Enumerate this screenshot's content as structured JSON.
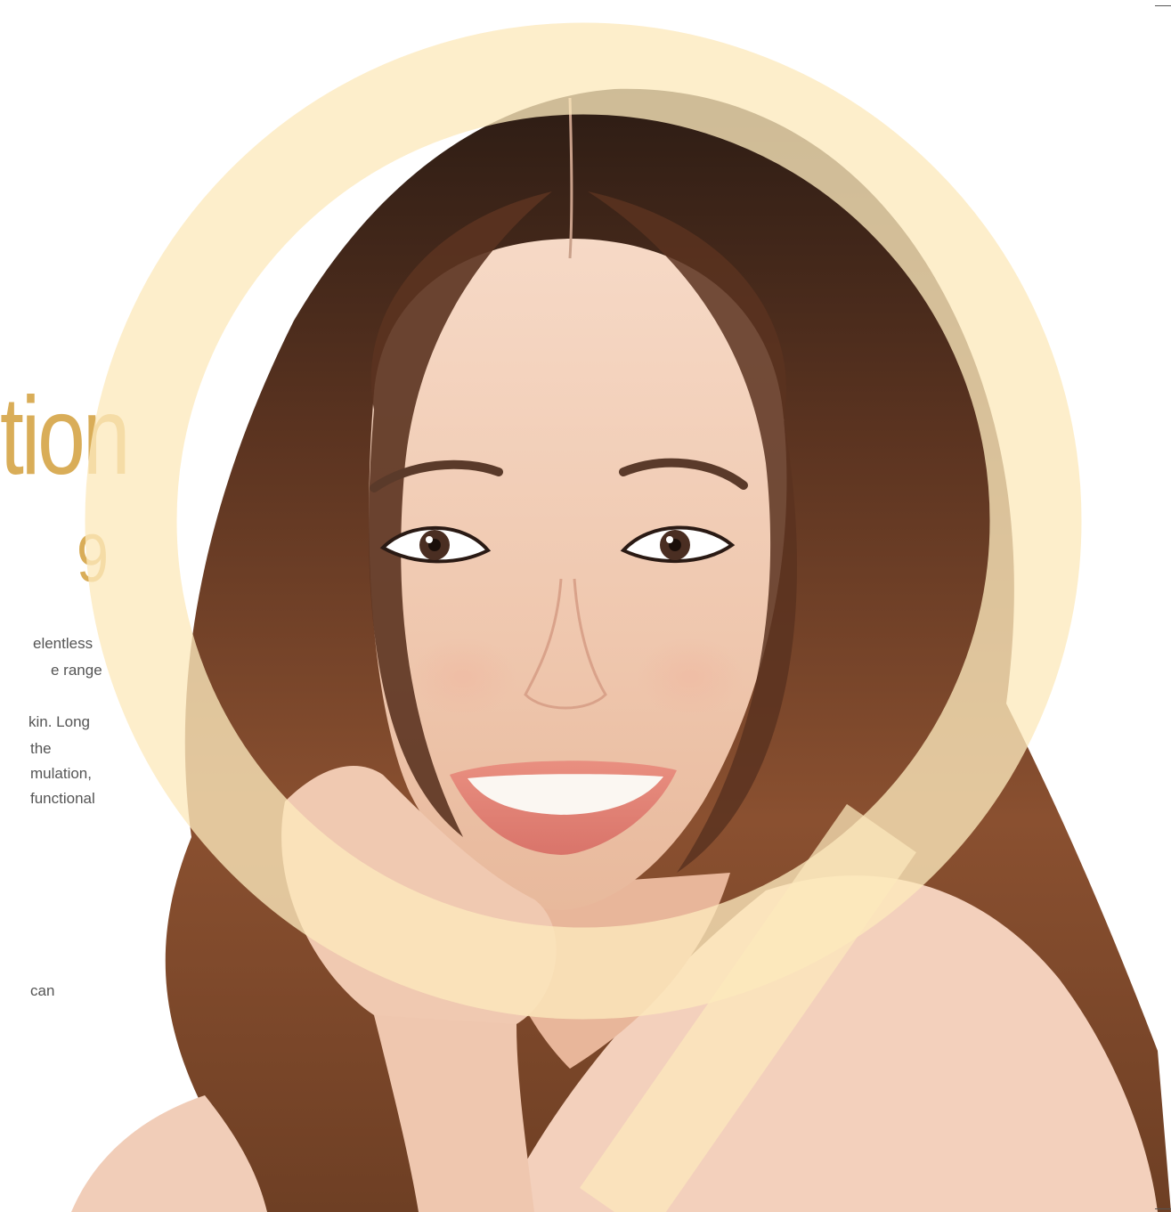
{
  "heading": "tion",
  "numeral": "9",
  "paragraph": {
    "line_1": "elentless",
    "line_2": "e range",
    "line_3": "kin. Long",
    "line_4": "the",
    "line_5": "mulation,",
    "line_6": "functional",
    "line_7": "can"
  },
  "colors": {
    "accent_gold": "#d9ad58",
    "ring_cream": "#fcecc4",
    "body_text": "#555555",
    "background": "#ffffff"
  },
  "photo": {
    "subject": "smiling-woman-portrait"
  }
}
